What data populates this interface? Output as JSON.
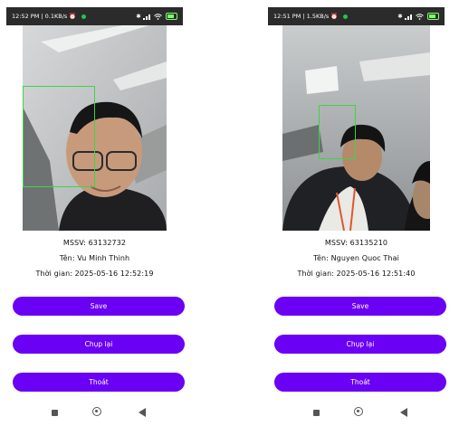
{
  "phones": [
    {
      "status_time": "12:52 PM | 0.1KB/s",
      "battery": "100",
      "mssv_line": "MSSV: 63132732",
      "name_line": "Tên: Vu Minh Thinh",
      "time_line": "Thời gian: 2025-05-16 12:52:19",
      "buttons": {
        "save": "Save",
        "retake": "Chụp lại",
        "exit": "Thoát"
      }
    },
    {
      "status_time": "12:51 PM | 1.5KB/s",
      "battery": "100",
      "mssv_line": "MSSV: 63135210",
      "name_line": "Tên: Nguyen Quoc Thai",
      "time_line": "Thời gian: 2025-05-16 12:51:40",
      "buttons": {
        "save": "Save",
        "retake": "Chụp lại",
        "exit": "Thoát"
      }
    }
  ],
  "colors": {
    "button_bg": "#6a00f4",
    "face_box": "#3fd447",
    "status_bar": "#2b2b2b"
  },
  "icons": [
    "alarm-icon",
    "bluetooth-icon",
    "signal-icon",
    "wifi-icon",
    "battery-icon",
    "nav-recents-icon",
    "nav-home-icon",
    "nav-back-icon"
  ]
}
